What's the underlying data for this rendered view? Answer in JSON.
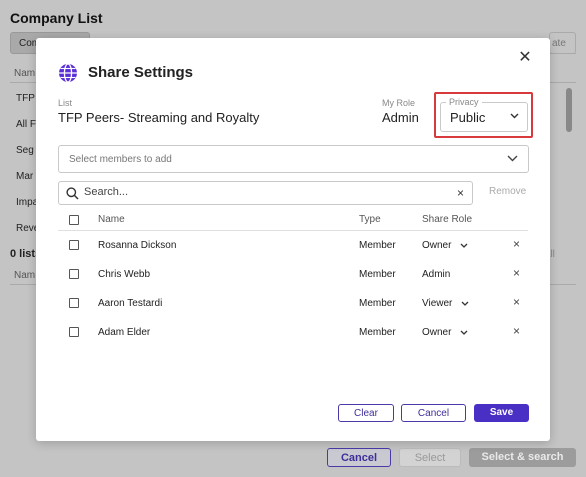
{
  "background": {
    "title": "Company List",
    "tab_label": "Com",
    "right_button_label": "ate",
    "column_header": "Nam",
    "rows": [
      "TFP",
      "All F",
      "Seg",
      "Mar",
      "Impa",
      "Reve"
    ],
    "lists_count": "0 lists",
    "column_header_2": "Nam",
    "view_all_label": "e All",
    "cancel_label": "Cancel",
    "select_label": "Select",
    "select_search_label": "Select & search"
  },
  "modal": {
    "title": "Share Settings",
    "list_label": "List",
    "list_name": "TFP Peers- Streaming and Royalty",
    "my_role_label": "My Role",
    "my_role_value": "Admin",
    "privacy_label": "Privacy",
    "privacy_value": "Public",
    "members_placeholder": "Select members to add",
    "search_placeholder": "Search...",
    "remove_label": "Remove",
    "columns": {
      "name": "Name",
      "type": "Type",
      "share_role": "Share Role"
    },
    "members": [
      {
        "name": "Rosanna Dickson",
        "type": "Member",
        "role": "Owner",
        "has_dropdown": true,
        "removable": true
      },
      {
        "name": "Chris Webb",
        "type": "Member",
        "role": "Admin",
        "has_dropdown": false,
        "removable": true
      },
      {
        "name": "Aaron Testardi",
        "type": "Member",
        "role": "Viewer",
        "has_dropdown": true,
        "removable": true
      },
      {
        "name": "Adam Elder",
        "type": "Member",
        "role": "Owner",
        "has_dropdown": true,
        "removable": true
      }
    ],
    "buttons": {
      "clear": "Clear",
      "cancel": "Cancel",
      "save": "Save"
    }
  },
  "colors": {
    "accent": "#4a2fc4",
    "highlight": "#d8393c",
    "globe": "#5b2fd6"
  }
}
